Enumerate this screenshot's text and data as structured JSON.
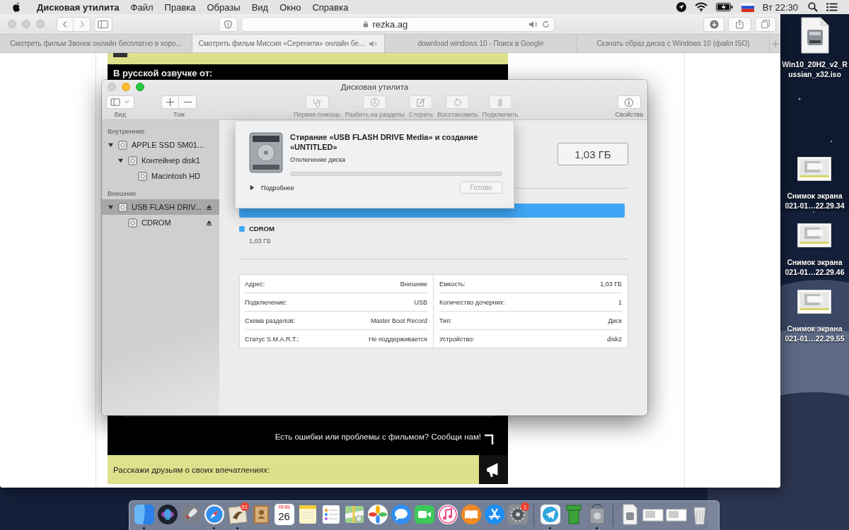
{
  "menu_bar": {
    "app_name": "Дисковая утилита",
    "menus": [
      "Файл",
      "Правка",
      "Образы",
      "Вид",
      "Окно",
      "Справка"
    ],
    "clock": "Вт 22:30"
  },
  "browser": {
    "address": "rezka.ag",
    "tabs": [
      {
        "title": "Смотреть фильм Звонок онлайн бесплатно в хоро...",
        "selected": false,
        "audio": false
      },
      {
        "title": "Смотреть фильм Миссия «Серенити» онлайн бе...",
        "selected": true,
        "audio": true
      },
      {
        "title": "download windows 10 - Поиск в Google",
        "selected": false,
        "audio": false
      },
      {
        "title": "Скачать образ диска с Windows 10 (файл ISO)",
        "selected": false,
        "audio": false
      }
    ],
    "page": {
      "dub_heading": "В русской озвучке от:",
      "report_text": "Есть ошибки или проблемы с фильмом? Сообщи нам!",
      "share_text": "Расскажи друзьям о своих впечатлениях:"
    }
  },
  "disk_utility": {
    "title": "Дисковая утилита",
    "close_button": {
      "disabled": true
    },
    "toolbar": [
      {
        "kind": "view",
        "label": "Вид",
        "disabled": false
      },
      {
        "kind": "volume",
        "label": "Том",
        "disabled": false
      },
      {
        "kind": "first-aid",
        "label": "Первая помощь",
        "disabled": true
      },
      {
        "kind": "partition",
        "label": "Разбить на разделы",
        "disabled": true
      },
      {
        "kind": "erase",
        "label": "Стереть",
        "disabled": true
      },
      {
        "kind": "restore",
        "label": "Восстановить",
        "disabled": true
      },
      {
        "kind": "mount",
        "label": "Подключить",
        "disabled": true
      },
      {
        "kind": "info",
        "label": "Свойства",
        "disabled": false
      }
    ],
    "sidebar": {
      "sections": [
        {
          "heading": "Внутренние",
          "items": [
            {
              "name": "APPLE SSD SM01...",
              "selected": false,
              "eject": false,
              "expanded": true,
              "children": [
                {
                  "name": "Контейнер disk1",
                  "selected": false,
                  "eject": false,
                  "expanded": true,
                  "children": [
                    {
                      "name": "Macintosh HD",
                      "selected": false,
                      "eject": false
                    }
                  ]
                }
              ]
            }
          ]
        },
        {
          "heading": "Внешние",
          "items": [
            {
              "name": "USB FLASH DRIV...",
              "selected": true,
              "eject": true,
              "expanded": true,
              "children": [
                {
                  "name": "CDROM",
                  "selected": false,
                  "eject": true
                }
              ]
            }
          ]
        }
      ]
    },
    "sheet": {
      "title": "Стирание «USB FLASH DRIVE Media» и создание «UNTITLED»",
      "status": "Отключение диска",
      "level": 0,
      "details": {
        "label": "Подробнее",
        "expanded": false
      },
      "done_button": {
        "label": "Готово",
        "disabled": true
      }
    },
    "capacity": "1,03 ГБ",
    "partitions": [
      {
        "name": "CDROM",
        "size": "1,03 ГБ",
        "color": "#3ea6f4"
      }
    ],
    "info": {
      "left": [
        {
          "label": "Адрес:",
          "value": "Внешние"
        },
        {
          "label": "Подключение:",
          "value": "USB"
        },
        {
          "label": "Схема разделов:",
          "value": "Master Boot Record"
        },
        {
          "label": "Статус S.M.A.R.T.:",
          "value": "Не поддерживается"
        }
      ],
      "right": [
        {
          "label": "Емкость:",
          "value": "1,03 ГБ"
        },
        {
          "label": "Количество дочерних:",
          "value": "1"
        },
        {
          "label": "Тип:",
          "value": "Диск"
        },
        {
          "label": "Устройство:",
          "value": "disk2"
        }
      ]
    }
  },
  "desktop_icons": [
    {
      "kind": "file",
      "lines": [
        "Win10_20H2_v2_R",
        "ussian_x32.iso"
      ]
    },
    {
      "kind": "screenshot",
      "lines": [
        "Снимок экрана",
        "021-01…22.29.34"
      ]
    },
    {
      "kind": "screenshot",
      "lines": [
        "Снимок экрана",
        "021-01…22.29.46"
      ]
    },
    {
      "kind": "screenshot",
      "lines": [
        "Снимок экрана",
        "021-01…22.29.55"
      ]
    }
  ],
  "dock": {
    "items": [
      {
        "kind": "finder",
        "running": true
      },
      {
        "kind": "siri",
        "running": false
      },
      {
        "kind": "launchpad",
        "running": false
      },
      {
        "kind": "safari",
        "running": true
      },
      {
        "kind": "mail",
        "running": true,
        "badge": "51"
      },
      {
        "kind": "contacts",
        "running": false
      },
      {
        "kind": "calendar",
        "running": false,
        "month": "ЯНВ",
        "day": "26"
      },
      {
        "kind": "notes",
        "running": false
      },
      {
        "kind": "reminders",
        "running": false
      },
      {
        "kind": "maps",
        "running": false
      },
      {
        "kind": "photos",
        "running": false
      },
      {
        "kind": "messages",
        "running": false
      },
      {
        "kind": "facetime",
        "running": false
      },
      {
        "kind": "music",
        "running": false
      },
      {
        "kind": "books",
        "running": false
      },
      {
        "kind": "appstore",
        "running": false
      },
      {
        "kind": "prefs",
        "running": false,
        "badge": "1"
      },
      {
        "kind": "separator"
      },
      {
        "kind": "telegram",
        "running": true
      },
      {
        "kind": "pipe",
        "running": false
      },
      {
        "kind": "diskutility",
        "running": true
      },
      {
        "kind": "separator"
      },
      {
        "kind": "file",
        "running": false
      },
      {
        "kind": "screenshot",
        "running": false
      },
      {
        "kind": "screenshot",
        "running": false
      },
      {
        "kind": "trash",
        "running": false
      }
    ]
  }
}
